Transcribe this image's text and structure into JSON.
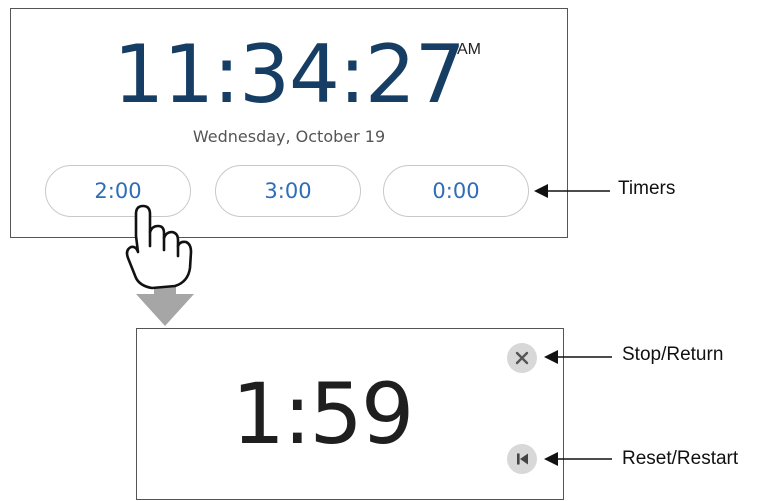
{
  "clock": {
    "time": "11:34:27",
    "period": "AM",
    "date": "Wednesday, October 19",
    "timers": [
      "2:00",
      "3:00",
      "0:00"
    ]
  },
  "countdown": {
    "value": "1:59",
    "stop_icon": "close-icon",
    "reset_icon": "skip-to-start-icon"
  },
  "callouts": {
    "timers": "Timers",
    "stop": "Stop/Return",
    "reset": "Reset/Restart"
  },
  "colors": {
    "clock_text": "#163d63",
    "timer_text": "#2f6db5",
    "transition_arrow": "#a6a6a6",
    "button_bg": "#d8d8d8"
  }
}
